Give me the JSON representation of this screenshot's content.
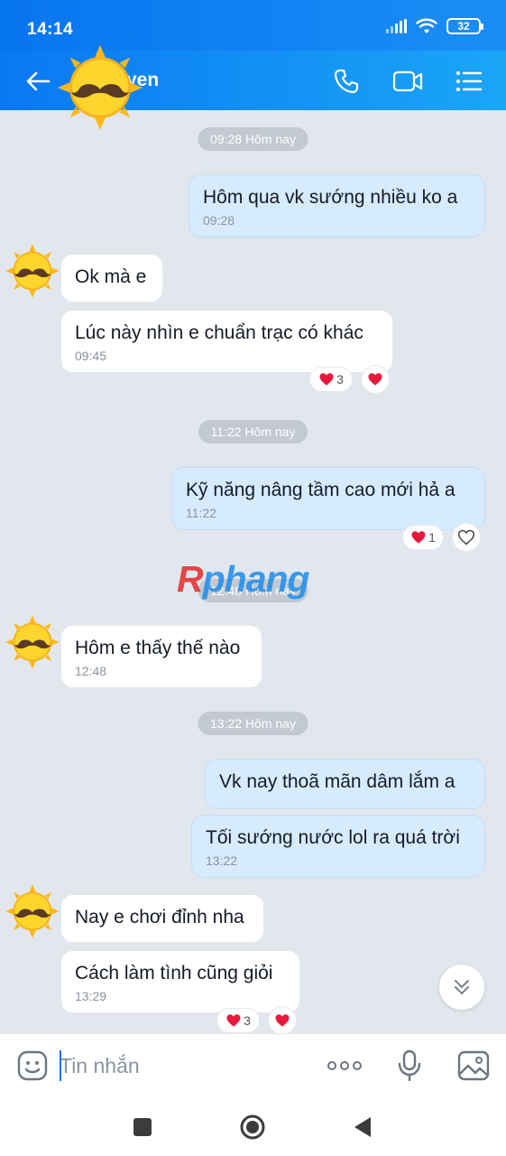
{
  "status_bar": {
    "time": "14:14",
    "battery": "32"
  },
  "header": {
    "contact_name": "yen"
  },
  "colors": {
    "header_blue": "#0a78f2",
    "outgoing_bubble": "#d6ebfe",
    "incoming_bubble": "#ffffff",
    "chat_bg": "#e2e7ee",
    "heart": "#e8193c"
  },
  "watermark": {
    "first": "R",
    "rest": "phang"
  },
  "messages": [
    {
      "kind": "time",
      "text": "09:28 Hôm nay"
    },
    {
      "kind": "out",
      "text": "Hôm qua vk sướng nhiều ko a",
      "time": "09:28"
    },
    {
      "kind": "in",
      "text": "Ok mà e"
    },
    {
      "kind": "in",
      "text": "Lúc này nhìn e chuẩn trạc có khác",
      "time": "09:45",
      "reaction_count": "3"
    },
    {
      "kind": "time",
      "text": "11:22 Hôm nay"
    },
    {
      "kind": "out",
      "text": "Kỹ năng nâng tầm cao mới hả a",
      "time": "11:22",
      "reaction_count": "1"
    },
    {
      "kind": "time",
      "text": "12:48 Hôm nay"
    },
    {
      "kind": "in",
      "text": "Hôm e thấy thế nào",
      "time": "12:48"
    },
    {
      "kind": "time",
      "text": "13:22 Hôm nay"
    },
    {
      "kind": "out",
      "text": "Vk nay thoã mãn dâm lắm a"
    },
    {
      "kind": "out",
      "text": "Tối sướng nước lol ra quá trời",
      "time": "13:22"
    },
    {
      "kind": "in",
      "text": "Nay e chơi đỉnh nha"
    },
    {
      "kind": "in",
      "text": "Cách làm tình cũng giỏi",
      "time": "13:29",
      "reaction_count": "3"
    }
  ],
  "input": {
    "placeholder": "Tin nhắn"
  },
  "icons": {
    "back": "arrow-left-icon",
    "call": "phone-icon",
    "video": "video-camera-icon",
    "menu": "list-menu-icon",
    "emoji": "sticker-icon",
    "more": "more-dots-icon",
    "mic": "microphone-icon",
    "image": "image-icon",
    "heart": "heart-icon",
    "scroll": "chevron-double-down-icon"
  }
}
